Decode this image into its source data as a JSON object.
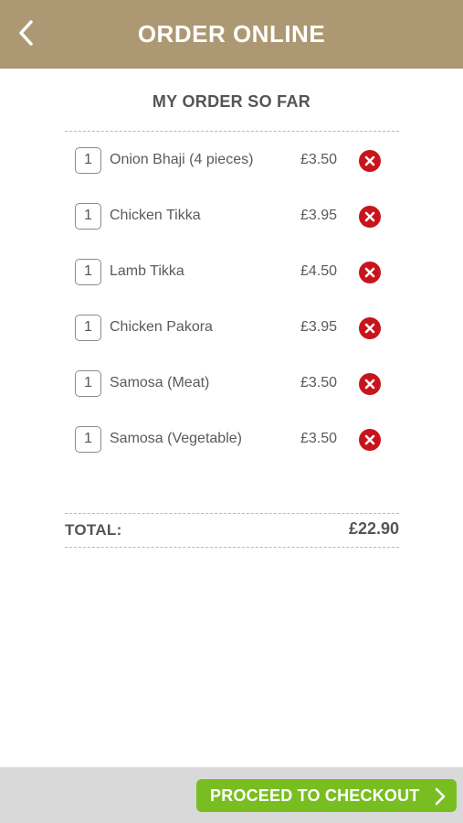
{
  "header": {
    "title": "ORDER ONLINE",
    "back_icon": "chevron-left-icon",
    "background": "#ac9872"
  },
  "order": {
    "title": "MY ORDER SO FAR",
    "items": [
      {
        "qty": "1",
        "name": "Onion Bhaji (4 pieces)",
        "price": "£3.50"
      },
      {
        "qty": "1",
        "name": "Chicken Tikka",
        "price": "£3.95"
      },
      {
        "qty": "1",
        "name": "Lamb Tikka",
        "price": "£4.50"
      },
      {
        "qty": "1",
        "name": "Chicken Pakora",
        "price": "£3.95"
      },
      {
        "qty": "1",
        "name": "Samosa (Meat)",
        "price": "£3.50"
      },
      {
        "qty": "1",
        "name": "Samosa (Vegetable)",
        "price": "£3.50"
      }
    ],
    "remove_icon": "remove-x-icon",
    "remove_color": "#c8141c",
    "total_label": "TOTAL:",
    "total_value": "£22.90"
  },
  "footer": {
    "checkout_label": "PROCEED TO CHECKOUT",
    "checkout_icon": "chevron-right-icon",
    "checkout_color": "#78be20"
  }
}
